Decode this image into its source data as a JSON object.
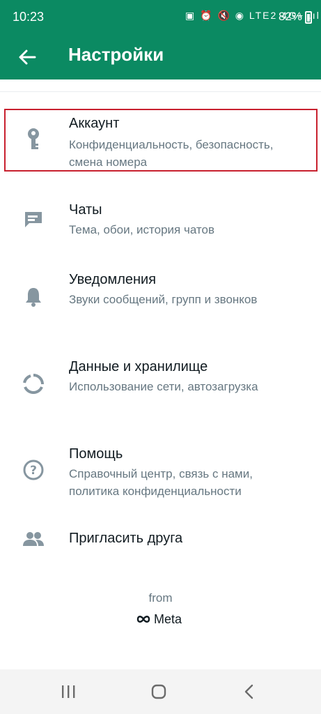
{
  "status_bar": {
    "time": "10:23",
    "indicators": "▣ ⏰ 🔇 ◉ LTE2 4G+ .ıl",
    "battery": "82%"
  },
  "app_bar": {
    "title": "Настройки",
    "back_icon": "arrow-left-icon"
  },
  "settings": [
    {
      "icon": "key-icon",
      "title": "Аккаунт",
      "subtitle": "Конфиденциальность, безопасность, смена номера"
    },
    {
      "icon": "chat-icon",
      "title": "Чаты",
      "subtitle": "Тема, обои, история чатов"
    },
    {
      "icon": "bell-icon",
      "title": "Уведомления",
      "subtitle": "Звуки сообщений, групп и звонков"
    },
    {
      "icon": "data-usage-icon",
      "title": "Данные и хранилище",
      "subtitle": "Использование сети, автозагрузка"
    },
    {
      "icon": "help-icon",
      "title": "Помощь",
      "subtitle": "Справочный центр, связь с нами, политика конфиденциальности"
    },
    {
      "icon": "people-icon",
      "title": "Пригласить друга",
      "subtitle": ""
    }
  ],
  "footer": {
    "from": "from",
    "brand": "Meta"
  },
  "nav_bar": {
    "recents_icon": "recents-icon",
    "home_icon": "home-icon",
    "back_icon": "back-chevron-icon"
  },
  "colors": {
    "header": "#0b8a62",
    "icon": "#8696a0",
    "highlight": "#c8202e"
  }
}
